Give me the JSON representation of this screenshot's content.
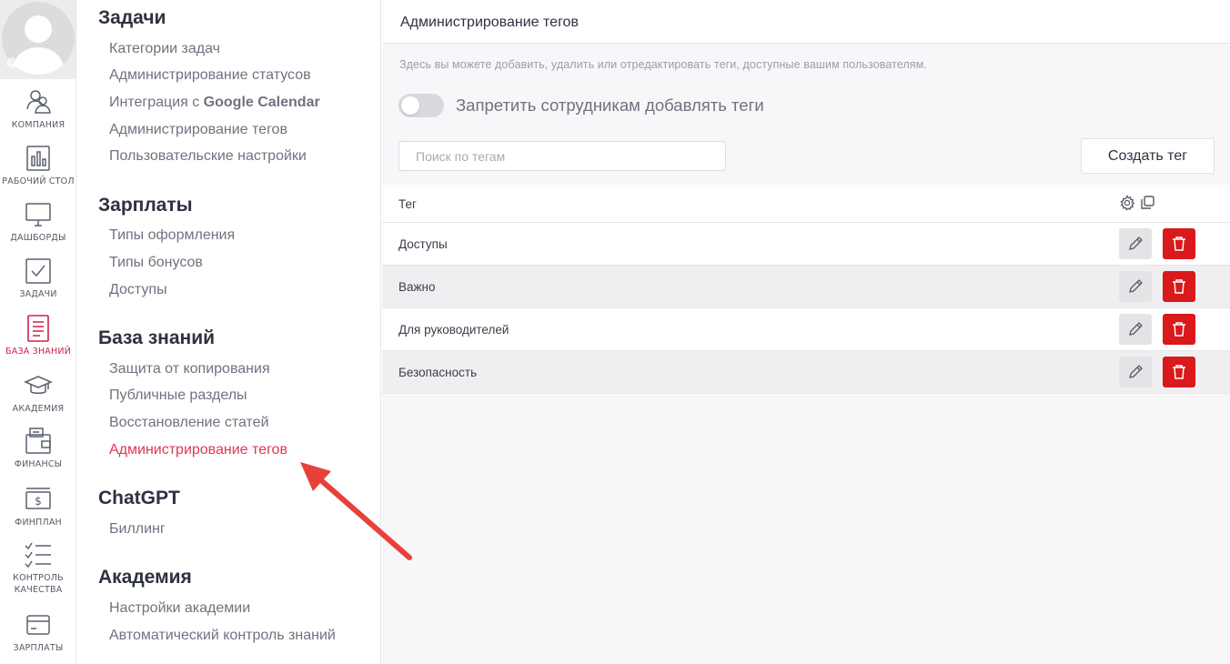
{
  "rail": {
    "items": [
      {
        "label": "КОМПАНИЯ",
        "icon": "people-icon"
      },
      {
        "label": "РАБОЧИЙ СТОЛ",
        "icon": "bar-chart-icon"
      },
      {
        "label": "ДАШБОРДЫ",
        "icon": "monitor-icon"
      },
      {
        "label": "ЗАДАЧИ",
        "icon": "checkbox-icon"
      },
      {
        "label": "БАЗА ЗНАНИЙ",
        "icon": "document-icon",
        "active": true
      },
      {
        "label": "АКАДЕМИЯ",
        "icon": "graduation-cap-icon"
      },
      {
        "label": "ФИНАНСЫ",
        "icon": "wallet-icon"
      },
      {
        "label": "ФИНПЛАН",
        "icon": "dollar-bill-icon"
      },
      {
        "label": "КОНТРОЛЬ",
        "label2": "КАЧЕСТВА",
        "icon": "checklist-icon"
      },
      {
        "label": "ЗАРПЛАТЫ",
        "icon": "card-icon"
      }
    ]
  },
  "menu": {
    "sections": [
      {
        "title": "Задачи",
        "links": [
          "Категории задач",
          "Администрирование статусов",
          "Интеграция с ",
          "Администрирование тегов",
          "Пользовательские настройки"
        ],
        "link_bold_suffix": "Google Calendar"
      },
      {
        "title": "Зарплаты",
        "links": [
          "Типы оформления",
          "Типы бонусов",
          "Доступы"
        ]
      },
      {
        "title": "База знаний",
        "links": [
          "Защита от копирования",
          "Публичные разделы",
          "Восстановление статей",
          "Администрирование тегов"
        ]
      },
      {
        "title": "ChatGPT",
        "links": [
          "Биллинг"
        ]
      },
      {
        "title": "Академия",
        "links": [
          "Настройки академии",
          "Автоматический контроль знаний"
        ]
      }
    ]
  },
  "main": {
    "title": "Администрирование тегов",
    "hint": "Здесь вы можете добавить, удалить или отредактировать теги, доступные вашим пользователям.",
    "toggle_label": "Запретить сотрудникам добавлять теги",
    "toggle_on": false,
    "search_placeholder": "Поиск по тегам",
    "create_button": "Создать тег",
    "table": {
      "header": "Тег",
      "rows": [
        "Доступы",
        "Важно",
        "Для руководителей",
        "Безопасность"
      ]
    }
  },
  "colors": {
    "accent": "#e2355a",
    "rail_active": "#c8234a",
    "delete": "#d9191b",
    "arrow": "#e8413a"
  }
}
